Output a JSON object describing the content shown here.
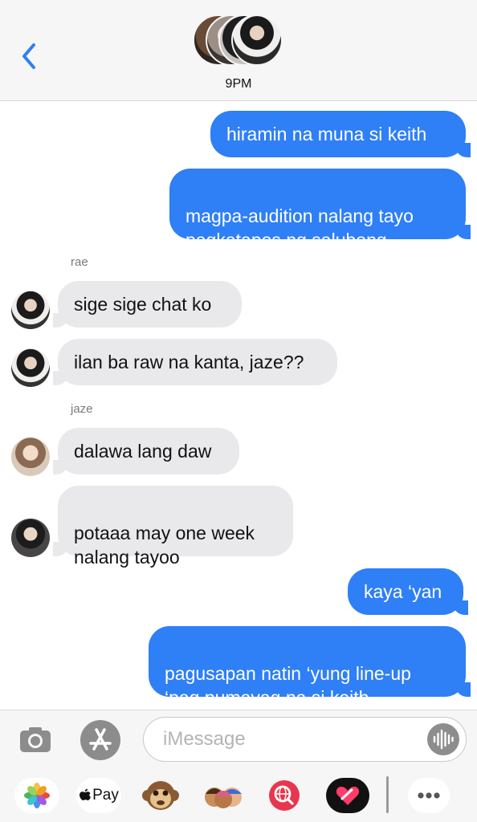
{
  "header": {
    "back_icon": "chevron-left-icon",
    "title": "9PM",
    "accent": "#2f7ff6"
  },
  "messages": [
    {
      "text": "hiramin na muna si keith",
      "direction": "outgoing"
    },
    {
      "text": "magpa-audition nalang tayo\npagkatapos ng salubong",
      "direction": "outgoing"
    },
    {
      "sender": "rae"
    },
    {
      "text": "sige sige chat ko",
      "direction": "incoming"
    },
    {
      "text": "ilan ba raw na kanta, jaze??",
      "direction": "incoming"
    },
    {
      "sender": "jaze"
    },
    {
      "text": "dalawa lang daw",
      "direction": "incoming"
    },
    {
      "text": "potaaa may one week\nnalang tayoo",
      "direction": "incoming"
    },
    {
      "text": "kaya ‘yan",
      "direction": "outgoing"
    },
    {
      "text": "pagusapan natin ‘yung line-up\n‘pag pumayag na si keith",
      "direction": "outgoing"
    }
  ],
  "composer": {
    "placeholder": "iMessage",
    "camera_icon": "camera-icon",
    "appstore_icon": "app-store-icon",
    "voice_icon": "audio-wave-icon"
  },
  "app_tray": {
    "apple_pay_label": "Pay",
    "icons": [
      "photos-icon",
      "apple-pay-icon",
      "monkey-emoji-icon",
      "memoji-icon",
      "web-search-icon",
      "digital-touch-icon",
      "more-icon"
    ]
  },
  "colors": {
    "outgoing_bubble": "#2f7ff6",
    "incoming_bubble": "#e9e9eb",
    "tray_background": "#f6f6f6"
  }
}
